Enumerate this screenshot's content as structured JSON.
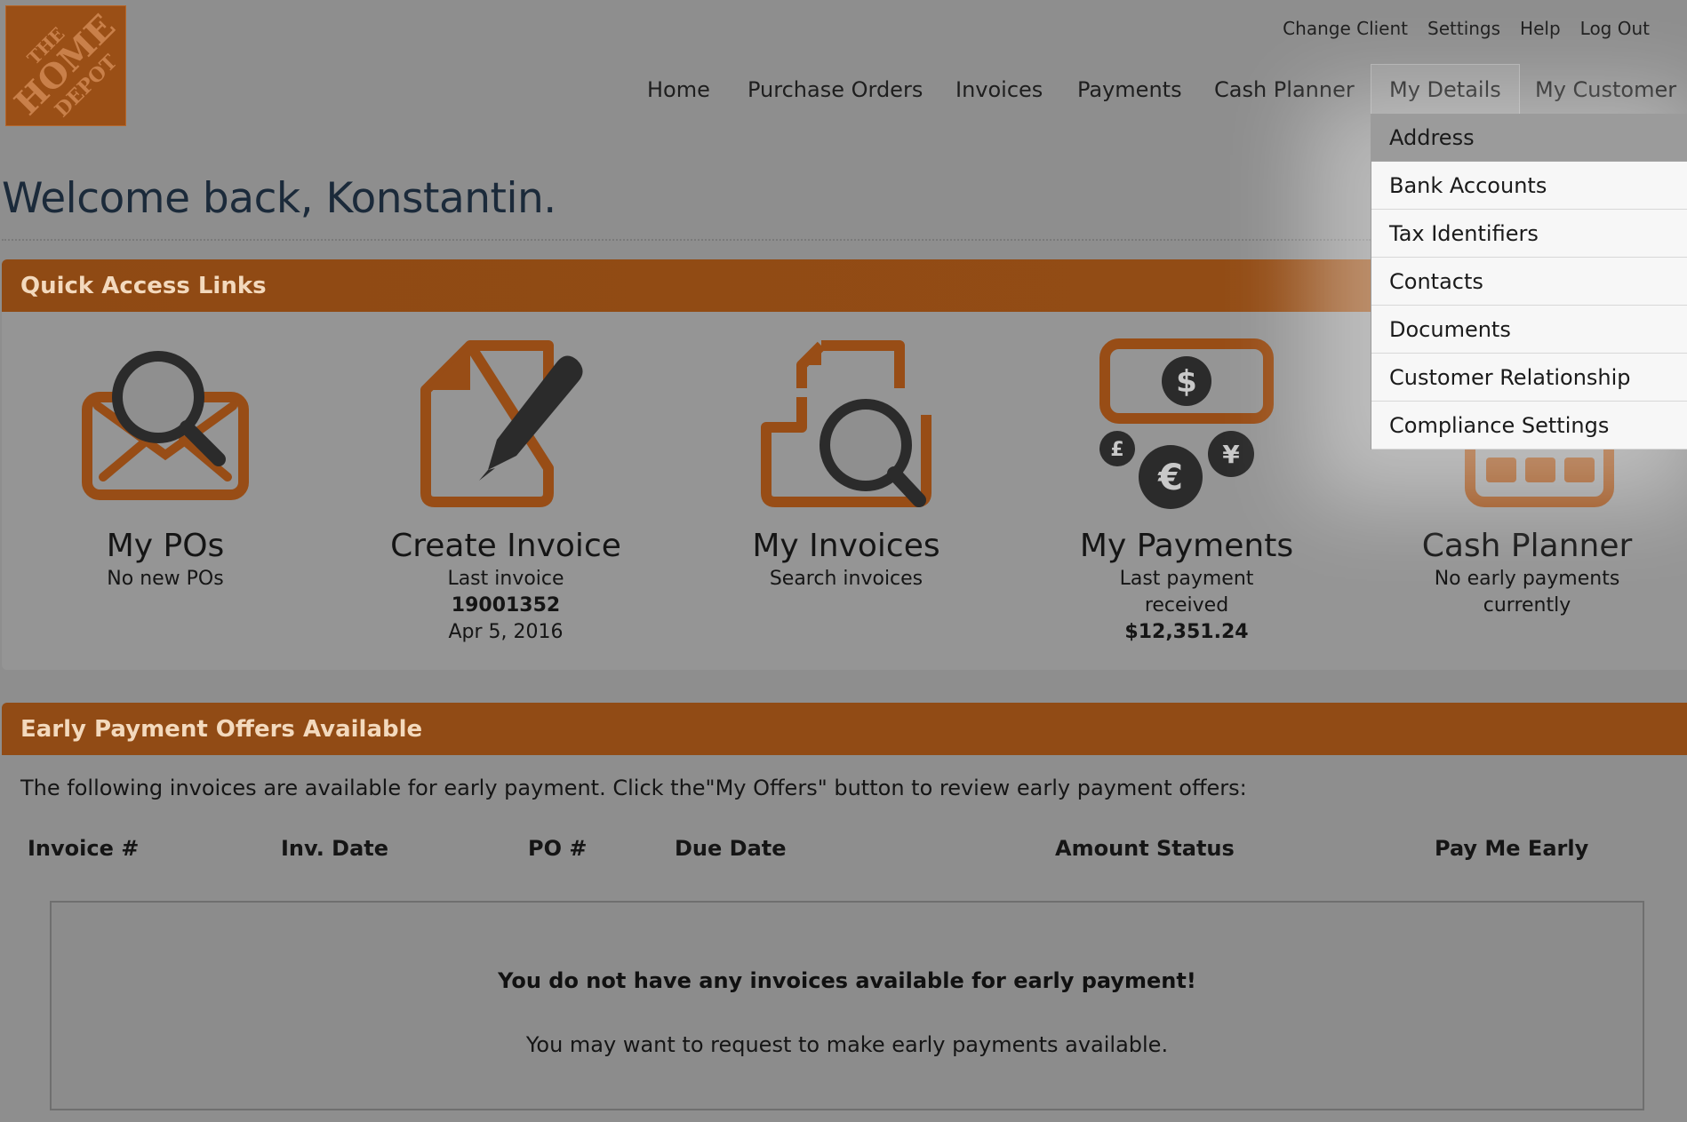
{
  "brand": {
    "logo_text": "THE HOME DEPOT",
    "logo_color": "#9a4f16",
    "accent": "#914b15"
  },
  "utility_nav": [
    "Change Client",
    "Settings",
    "Help",
    "Log Out"
  ],
  "main_nav": {
    "items": [
      "Home",
      "Purchase Orders",
      "Invoices",
      "Payments",
      "Cash Planner",
      "My Details",
      "My Customer"
    ],
    "active": "My Details"
  },
  "my_details_menu": [
    "Address",
    "Bank Accounts",
    "Tax Identifiers",
    "Contacts",
    "Documents",
    "Customer Relationship",
    "Compliance Settings"
  ],
  "welcome": "Welcome back, Konstantin.",
  "quick_access": {
    "title": "Quick Access Links",
    "tiles": [
      {
        "title": "My POs",
        "icon": "envelope-search-icon",
        "line1": "No new POs"
      },
      {
        "title": "Create Invoice",
        "icon": "document-pen-icon",
        "line1": "Last invoice",
        "bold": "19001352",
        "line2": "Apr 5, 2016"
      },
      {
        "title": "My Invoices",
        "icon": "document-search-icon",
        "line1": "Search invoices"
      },
      {
        "title": "My Payments",
        "icon": "currency-icon",
        "line1": "Last payment",
        "line2": "received",
        "bold": "$12,351.24"
      },
      {
        "title": "Cash Planner",
        "icon": "calendar-icon",
        "line1": "No early payments",
        "line2": "currently"
      }
    ]
  },
  "early_payment": {
    "title": "Early Payment Offers Available",
    "description": "The following invoices are available for early payment. Click the\"My Offers\" button to review early payment offers:",
    "columns": [
      "Invoice #",
      "Inv. Date",
      "PO #",
      "Due Date",
      "Amount",
      "Status",
      "Pay Me Early"
    ],
    "empty_title": "You do not have any invoices available for early payment!",
    "empty_subtitle": "You may want to request to make early payments available."
  }
}
